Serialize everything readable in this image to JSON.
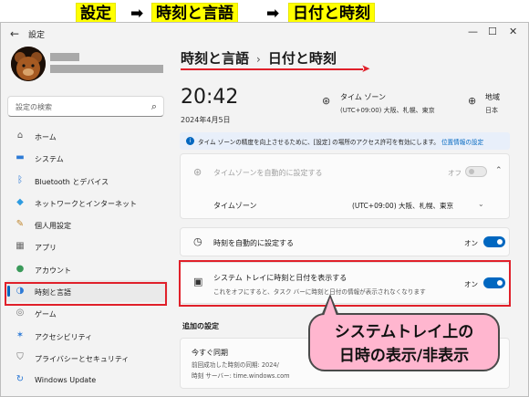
{
  "banner": {
    "step1": "設定",
    "step2": "時刻と言語",
    "step3": "日付と時刻",
    "arrow": "➡"
  },
  "window": {
    "title": "設定",
    "back_icon": "back-arrow-icon",
    "controls": [
      "—",
      "☐",
      "✕"
    ]
  },
  "sidebar": {
    "search_placeholder": "設定の検索",
    "items": [
      {
        "label": "ホーム",
        "icon": "home-icon",
        "glyph": "⌂"
      },
      {
        "label": "システム",
        "icon": "monitor-icon",
        "glyph": "▬"
      },
      {
        "label": "Bluetooth とデバイス",
        "icon": "bluetooth-icon",
        "glyph": "ᛒ"
      },
      {
        "label": "ネットワークとインターネット",
        "icon": "wifi-icon",
        "glyph": "◆"
      },
      {
        "label": "個人用設定",
        "icon": "brush-icon",
        "glyph": "✎"
      },
      {
        "label": "アプリ",
        "icon": "apps-icon",
        "glyph": "▦"
      },
      {
        "label": "アカウント",
        "icon": "account-icon",
        "glyph": "●"
      },
      {
        "label": "時刻と言語",
        "icon": "globe-clock-icon",
        "glyph": "◑"
      },
      {
        "label": "ゲーム",
        "icon": "gamepad-icon",
        "glyph": "◎"
      },
      {
        "label": "アクセシビリティ",
        "icon": "accessibility-icon",
        "glyph": "✶"
      },
      {
        "label": "プライバシーとセキュリティ",
        "icon": "shield-icon",
        "glyph": "⛉"
      },
      {
        "label": "Windows Update",
        "icon": "update-icon",
        "glyph": "↻"
      }
    ],
    "active_index": 7
  },
  "header": {
    "parent": "時刻と言語",
    "separator": "›",
    "current": "日付と時刻"
  },
  "summary": {
    "time": "20:42",
    "date": "2024年4月5日",
    "timezone_title": "タイム ゾーン",
    "timezone_value": "(UTC+09:00) 大阪、札幌、東京",
    "region_title": "地域",
    "region_value": "日本"
  },
  "info_bar": {
    "text": "タイム ゾーンの精度を向上させるために、[設定] の場所のアクセス許可を有効にします。",
    "link": "位置情報の設定"
  },
  "settings": {
    "auto_tz_label": "タイムゾーンを自動的に設定する",
    "auto_tz_state": "オフ",
    "tz_label": "タイムゾーン",
    "tz_value": "(UTC+09:00) 大阪、札幌、東京",
    "auto_time_label": "時刻を自動的に設定する",
    "auto_time_state": "オン",
    "tray_label": "システム トレイに時刻と日付を表示する",
    "tray_sub": "これをオフにすると、タスク バーに時刻と日付の情報が表示されなくなります",
    "tray_state": "オン"
  },
  "additional": {
    "heading": "追加の設定",
    "sync_label": "今すぐ同期",
    "sync_last": "前回成功した時刻の同期: 2024/",
    "sync_server": "時刻 サーバー: time.windows.com"
  },
  "callout": {
    "line1": "システムトレイ上の",
    "line2": "日時の表示/非表示"
  }
}
